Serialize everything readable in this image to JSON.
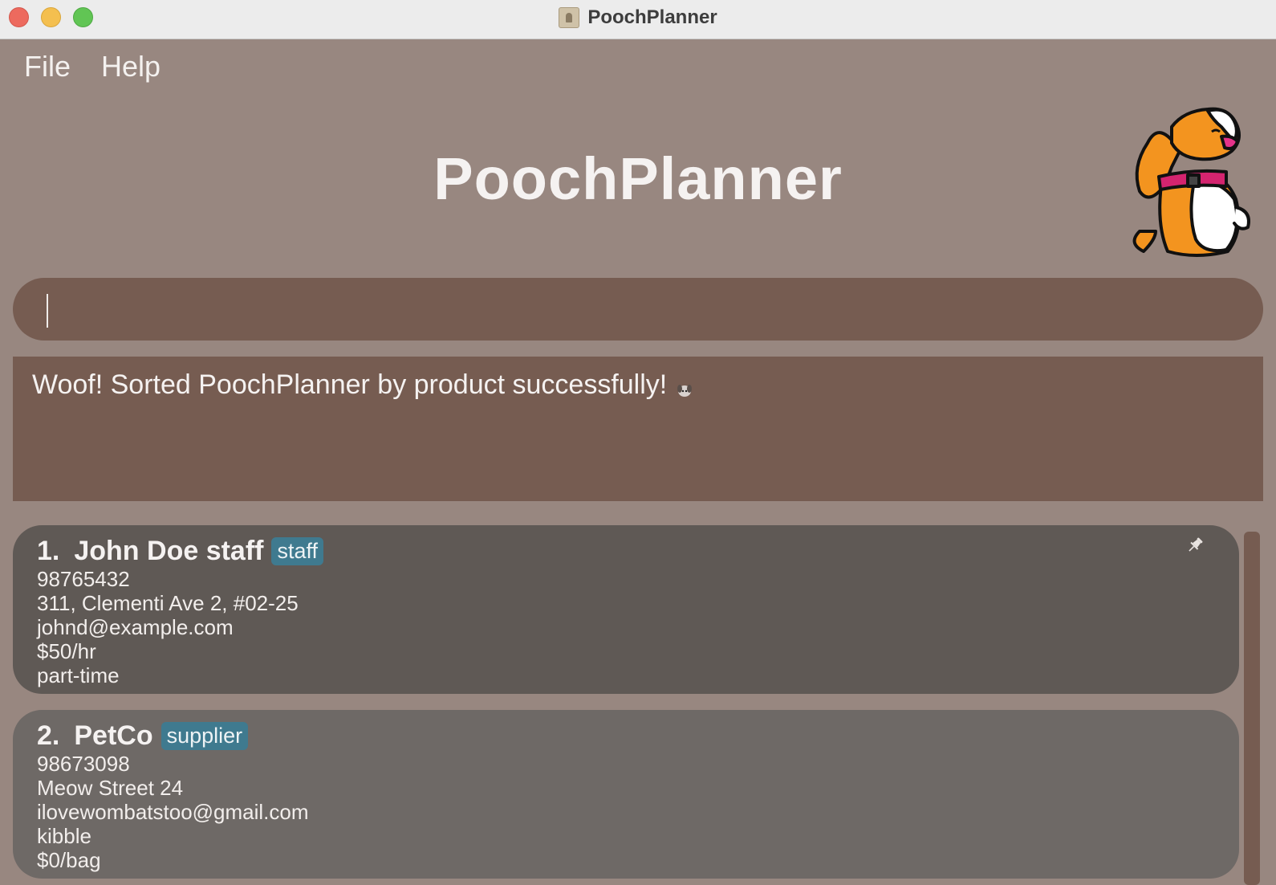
{
  "window": {
    "title": "PoochPlanner"
  },
  "menu": {
    "file": "File",
    "help": "Help"
  },
  "header": {
    "title": "PoochPlanner",
    "mascot_icon": "dog-mascot-icon"
  },
  "command": {
    "value": "",
    "placeholder": ""
  },
  "result": {
    "message": "Woof! Sorted PoochPlanner by product successfully!"
  },
  "contacts": [
    {
      "index": "1.",
      "name": "John Doe staff",
      "tag": "staff",
      "lines": [
        "98765432",
        "311, Clementi Ave 2, #02-25",
        "johnd@example.com",
        "$50/hr",
        "part-time"
      ],
      "pinned": true
    },
    {
      "index": "2.",
      "name": "PetCo",
      "tag": "supplier",
      "lines": [
        "98673098",
        "Meow Street 24",
        "ilovewombatstoo@gmail.com",
        "kibble",
        "$0/bag"
      ]
    }
  ],
  "colors": {
    "background": "#988780",
    "panel": "#765c51",
    "card_selected": "#5f5955",
    "card": "#6e6966",
    "tag": "#3f7a8f"
  }
}
